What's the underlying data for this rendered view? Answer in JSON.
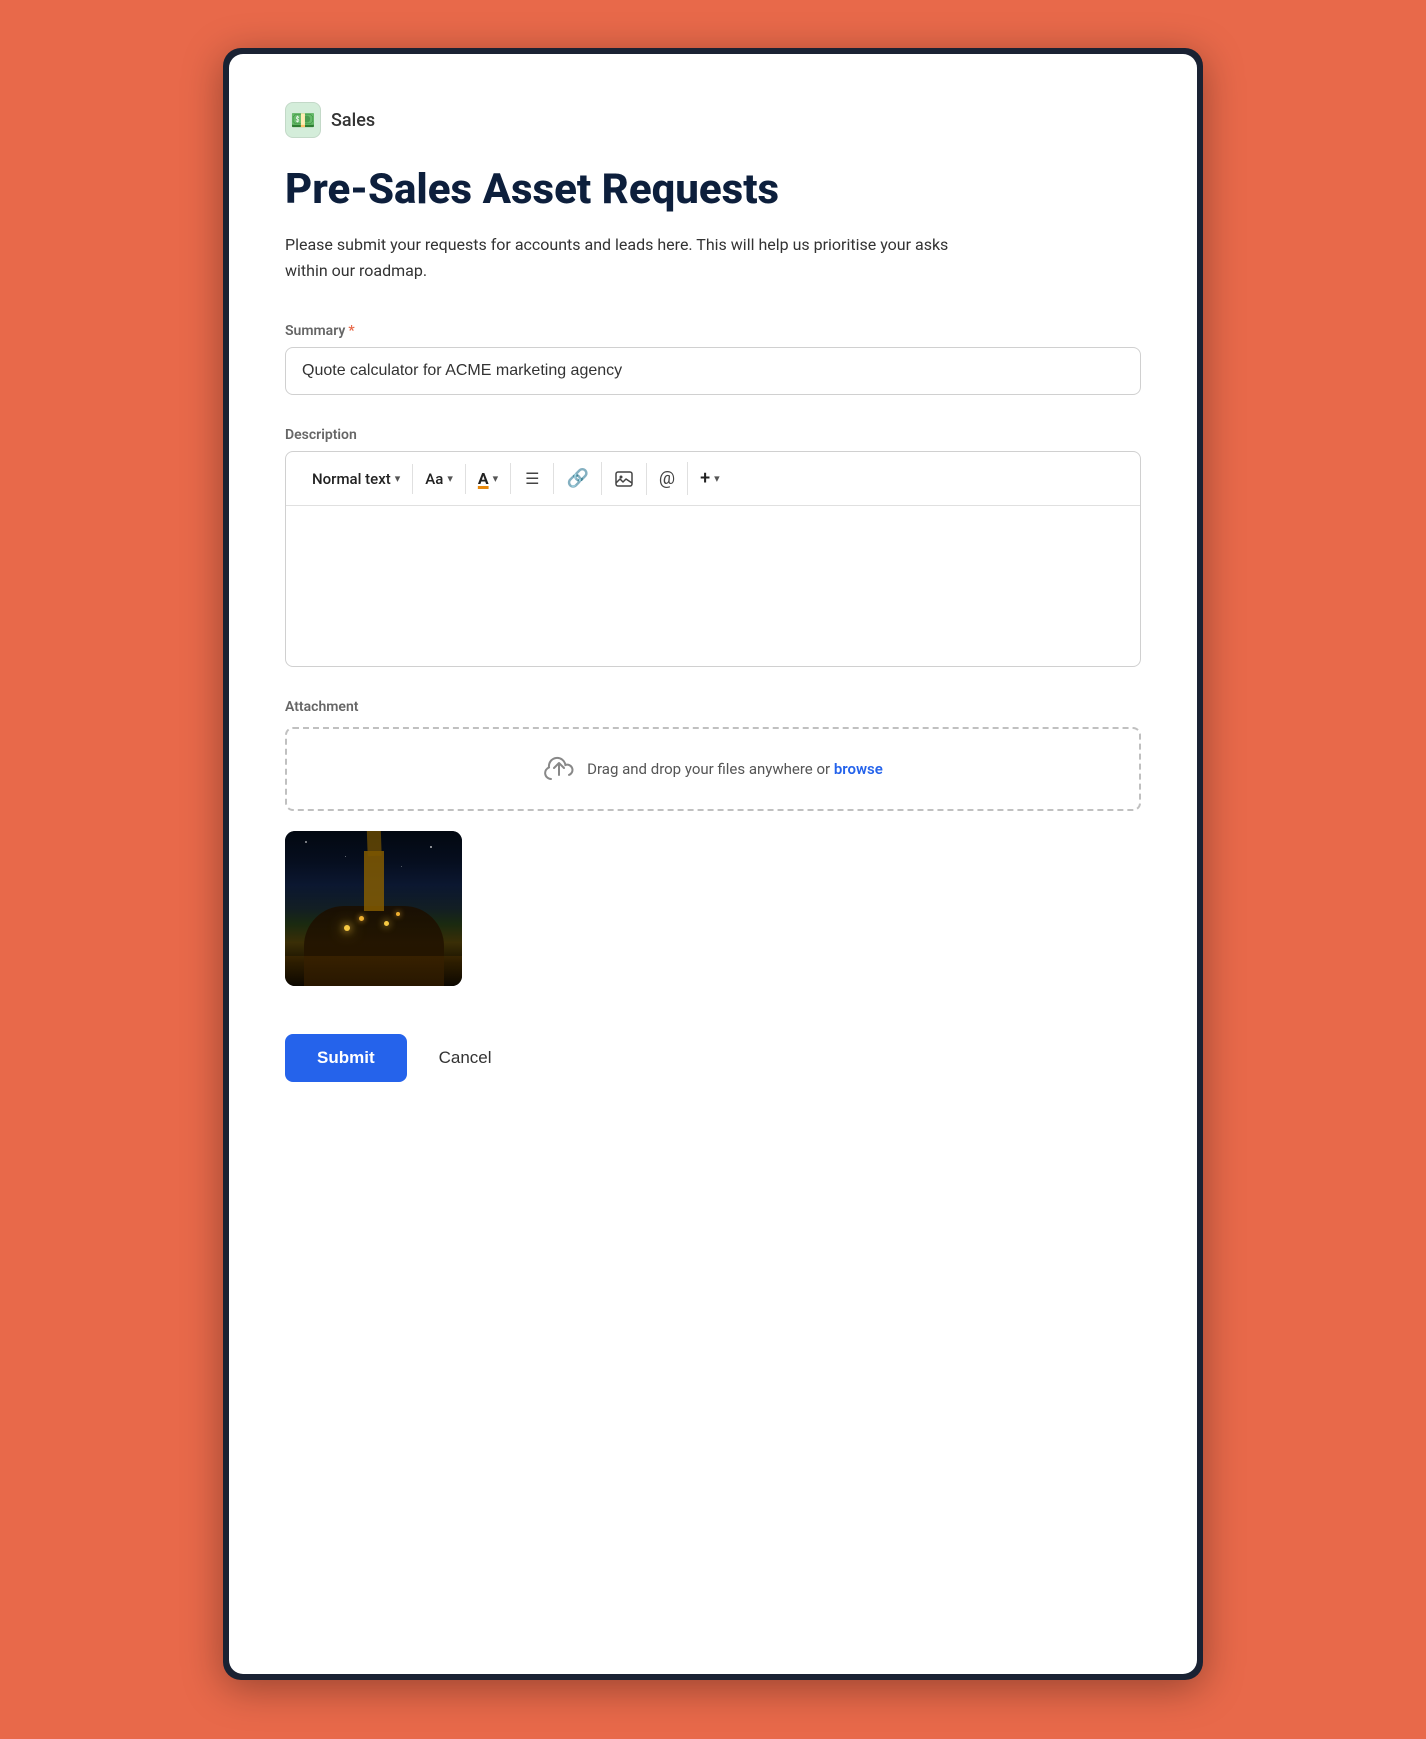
{
  "brand": {
    "icon": "💵",
    "name": "Sales"
  },
  "page": {
    "title": "Pre-Sales Asset Requests",
    "description": "Please submit your requests for accounts and leads here. This will help us prioritise your asks within our roadmap."
  },
  "summary_field": {
    "label": "Summary",
    "required": true,
    "value": "Quote calculator for ACME marketing agency",
    "placeholder": "Quote calculator for ACME marketing agency"
  },
  "description_field": {
    "label": "Description",
    "toolbar": {
      "text_style": "Normal text",
      "font": "Aa",
      "text_color": "A",
      "list": "≡",
      "link": "🔗",
      "image": "🖼",
      "mention": "@",
      "more": "+"
    }
  },
  "attachment_field": {
    "label": "Attachment",
    "drop_text": "Drag and drop your files anywhere or",
    "browse_link": "browse"
  },
  "actions": {
    "submit": "Submit",
    "cancel": "Cancel"
  }
}
